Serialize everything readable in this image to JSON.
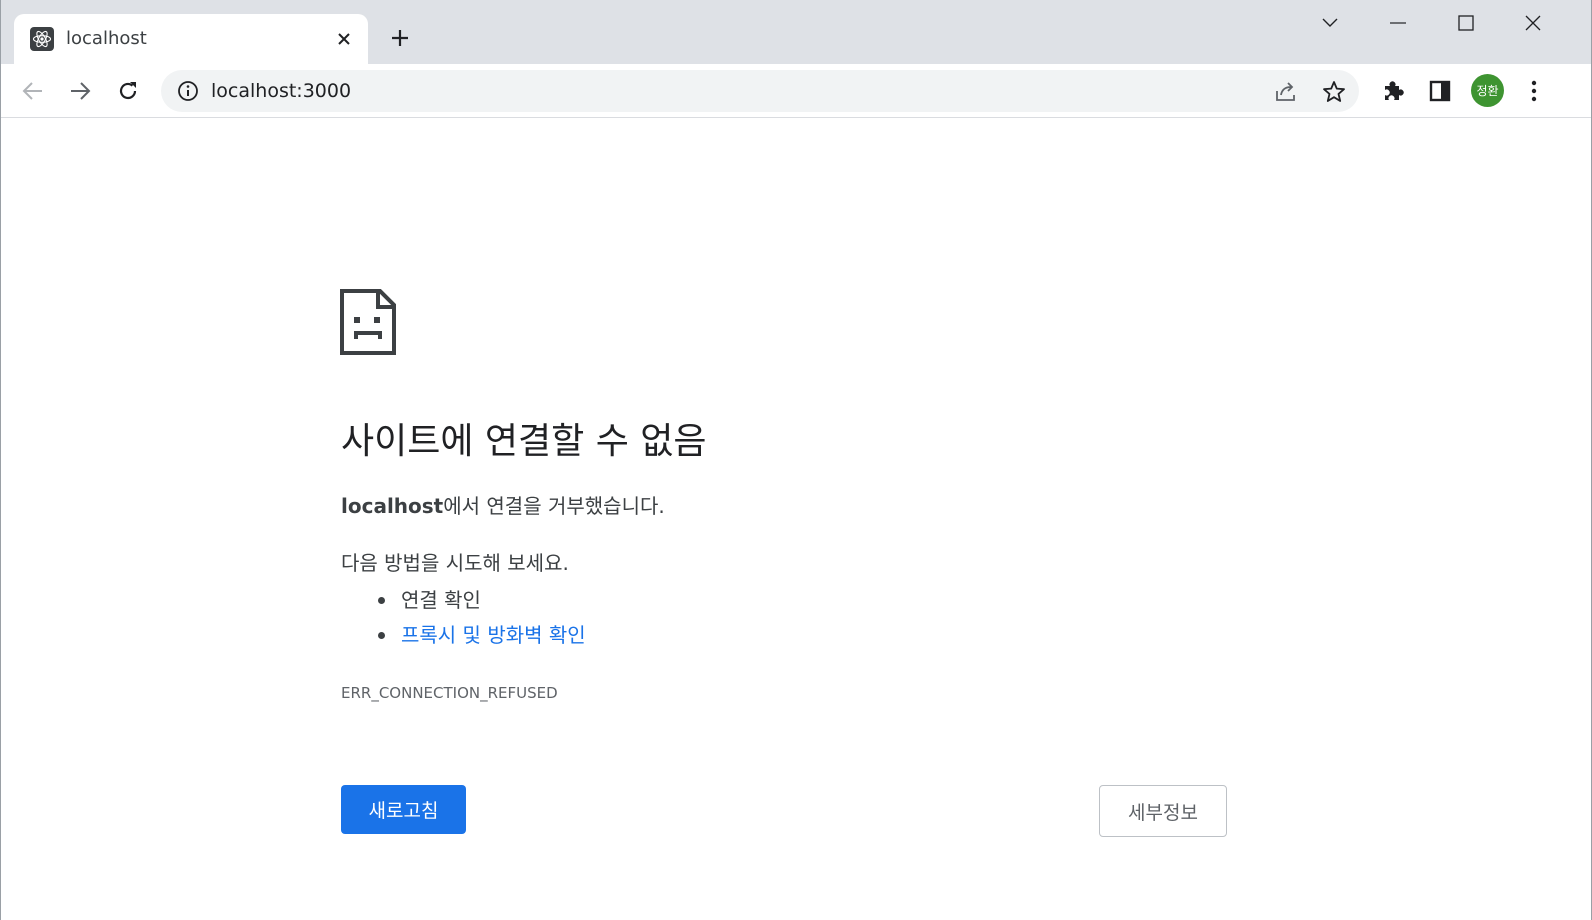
{
  "tab": {
    "title": "localhost",
    "favicon": "react-icon"
  },
  "omnibox": {
    "url": "localhost:3000"
  },
  "profile": {
    "initials": "정환",
    "color": "#3e9431"
  },
  "error": {
    "heading": "사이트에 연결할 수 없음",
    "host": "localhost",
    "message": "에서 연결을 거부했습니다.",
    "try_label": "다음 방법을 시도해 보세요.",
    "suggestions": [
      {
        "label": "연결 확인",
        "link": false
      },
      {
        "label": "프록시 및 방화벽 확인",
        "link": true
      }
    ],
    "code": "ERR_CONNECTION_REFUSED",
    "reload_label": "새로고침",
    "details_label": "세부정보"
  },
  "colors": {
    "accent": "#1a73e8",
    "tabstrip": "#dee1e6",
    "text": "#3c4043"
  }
}
